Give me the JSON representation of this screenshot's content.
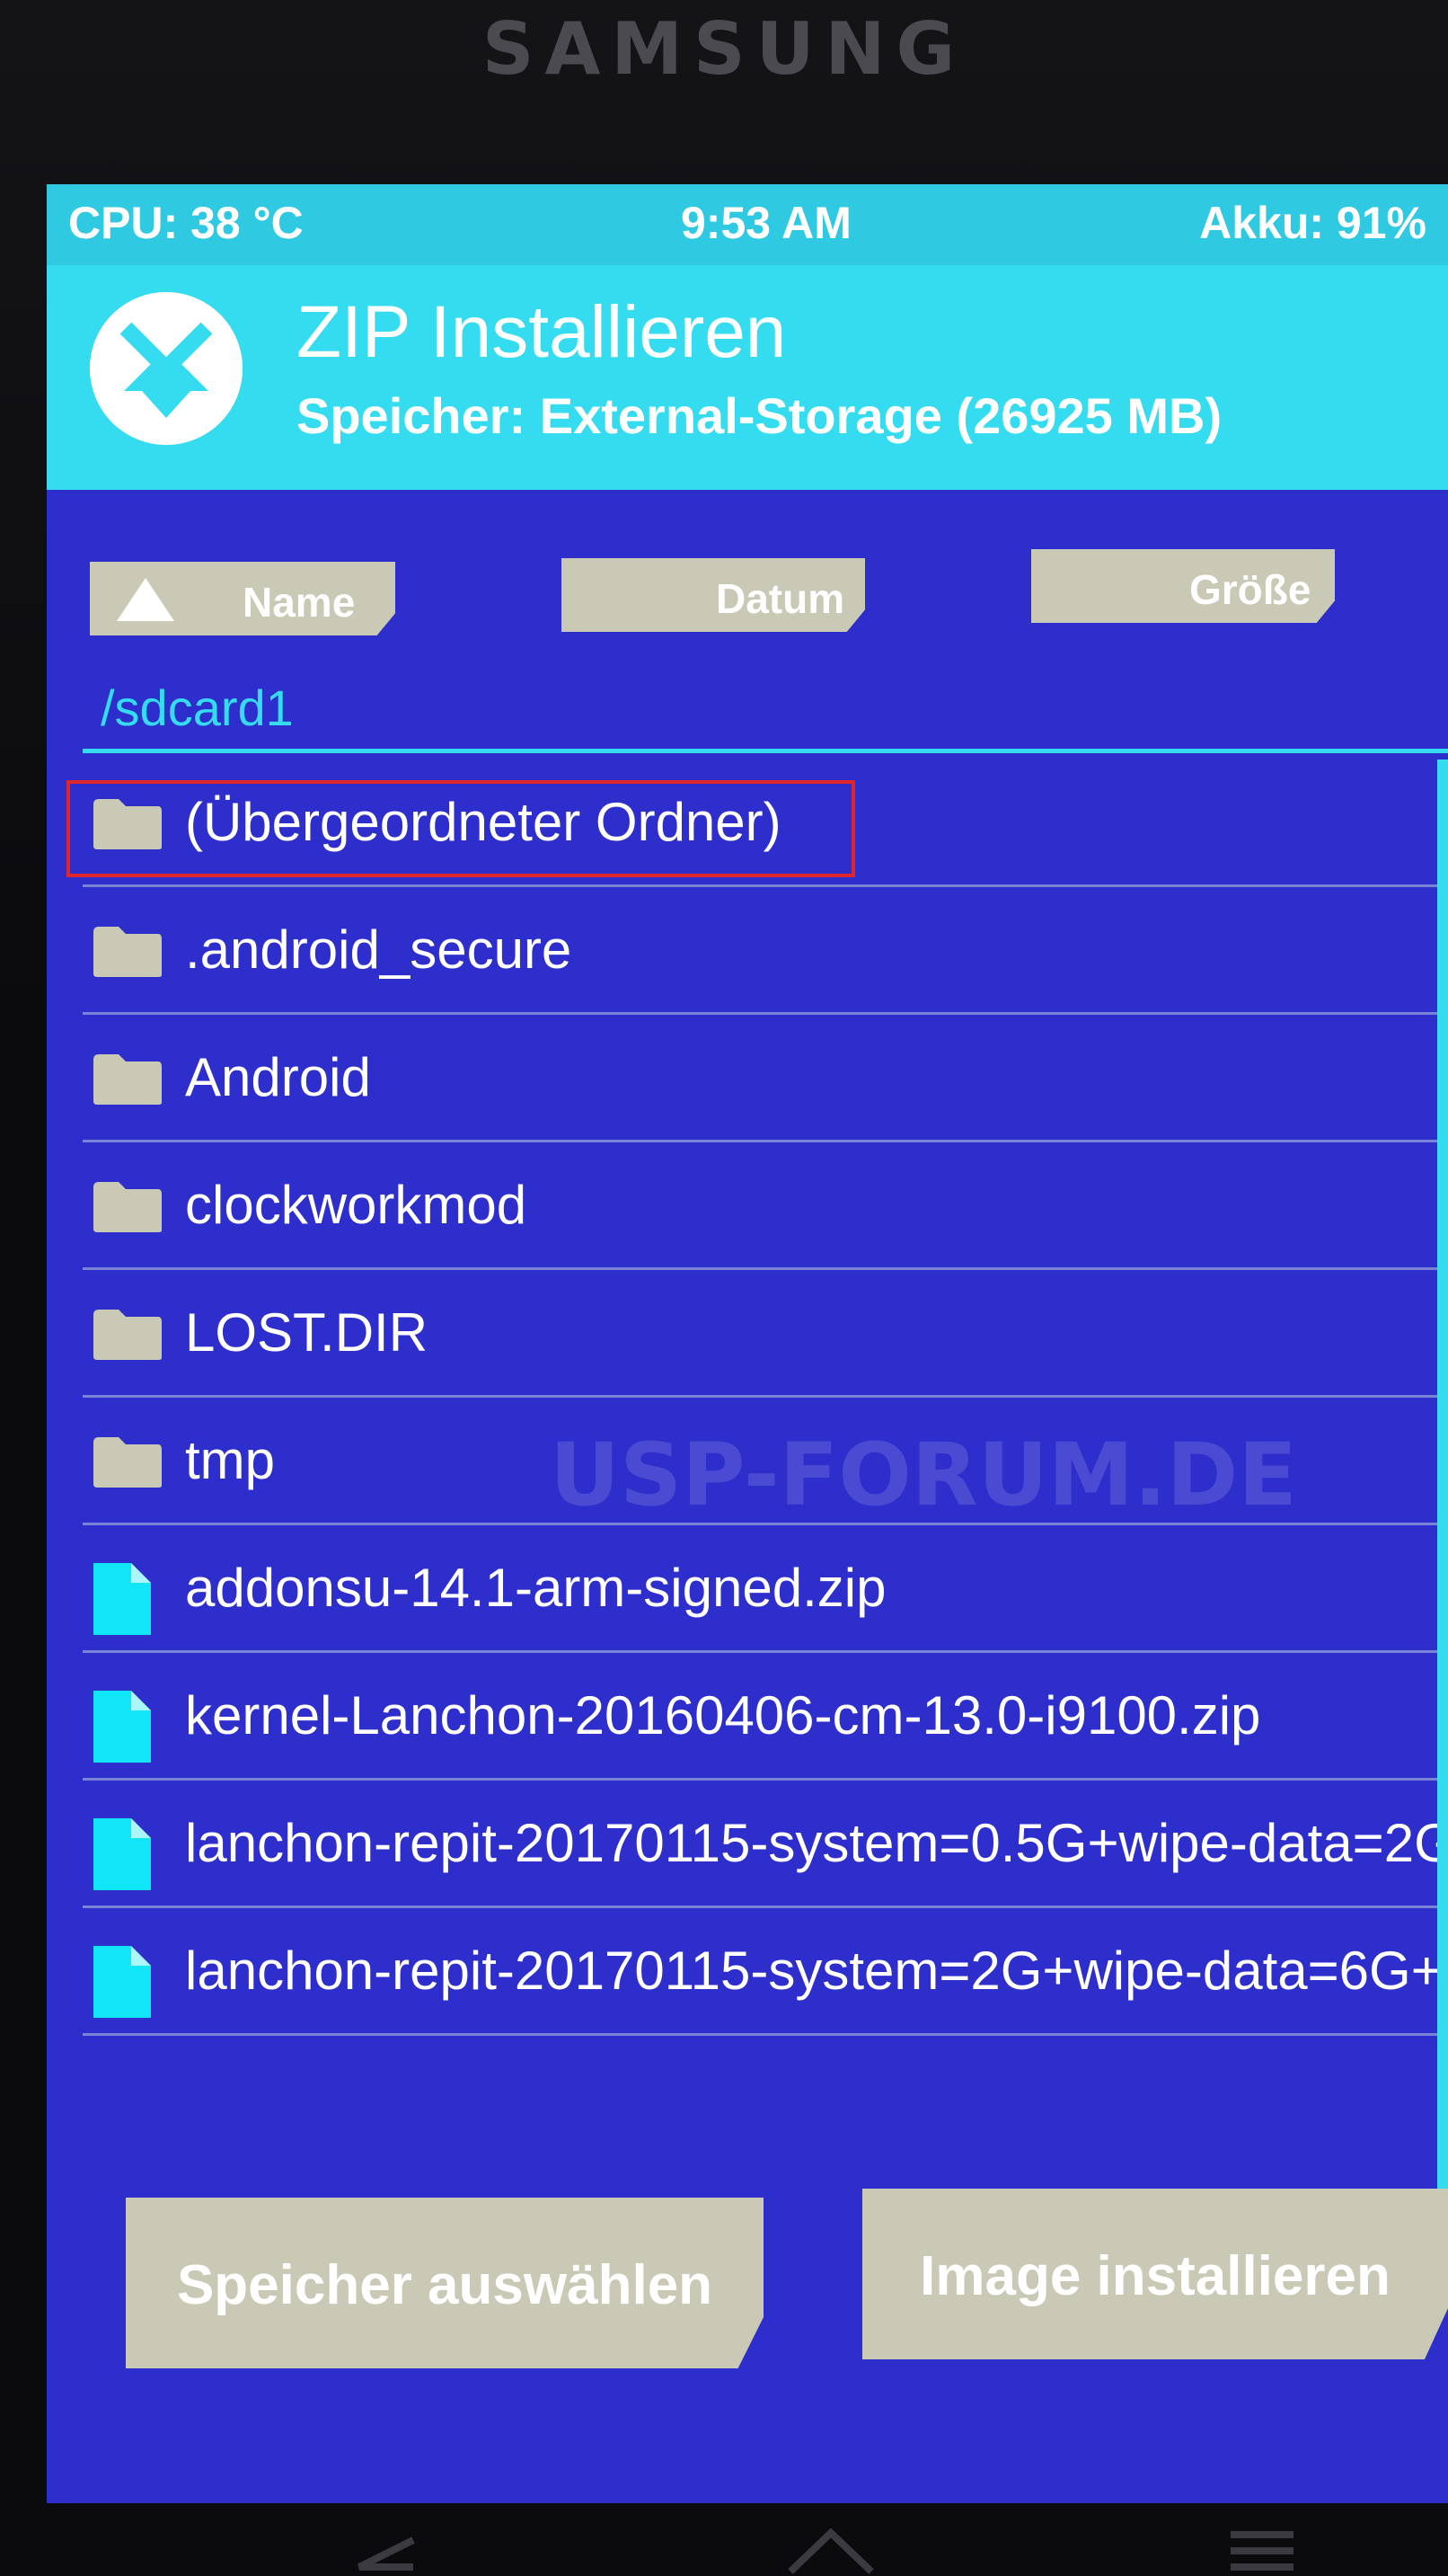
{
  "device": {
    "brand": "SAMSUNG"
  },
  "status": {
    "cpu": "CPU: 38 °C",
    "time": "9:53 AM",
    "battery": "Akku: 91%"
  },
  "header": {
    "title": "ZIP Installieren",
    "subtitle": "Speicher: External-Storage (26925 MB)"
  },
  "sort": {
    "name": "Name",
    "date": "Datum",
    "size": "Größe"
  },
  "path": "/sdcard1",
  "files": [
    {
      "label": "(Übergeordneter Ordner)",
      "icon": "folder-icon"
    },
    {
      "label": ".android_secure",
      "icon": "folder-icon"
    },
    {
      "label": "Android",
      "icon": "folder-icon"
    },
    {
      "label": "clockworkmod",
      "icon": "folder-icon"
    },
    {
      "label": "LOST.DIR",
      "icon": "folder-icon"
    },
    {
      "label": "tmp",
      "icon": "folder-icon"
    },
    {
      "label": "addonsu-14.1-arm-signed.zip",
      "icon": "file-icon"
    },
    {
      "label": "kernel-Lanchon-20160406-cm-13.0-i9100.zip",
      "icon": "file-icon"
    },
    {
      "label": "lanchon-repit-20170115-system=0.5G+wipe-data=2G",
      "icon": "file-icon"
    },
    {
      "label": "lanchon-repit-20170115-system=2G+wipe-data=6G+",
      "icon": "file-icon"
    }
  ],
  "buttons": {
    "storage": "Speicher auswählen",
    "image": "Image installieren"
  },
  "watermark": "USP-FORUM.DE",
  "colors": {
    "accent": "#35dcef",
    "background": "#2d2ecb",
    "button": "#c9c9b6",
    "highlight": "#e0262a",
    "file_icon": "#10e6f8",
    "folder_icon": "#c9c9b6"
  }
}
